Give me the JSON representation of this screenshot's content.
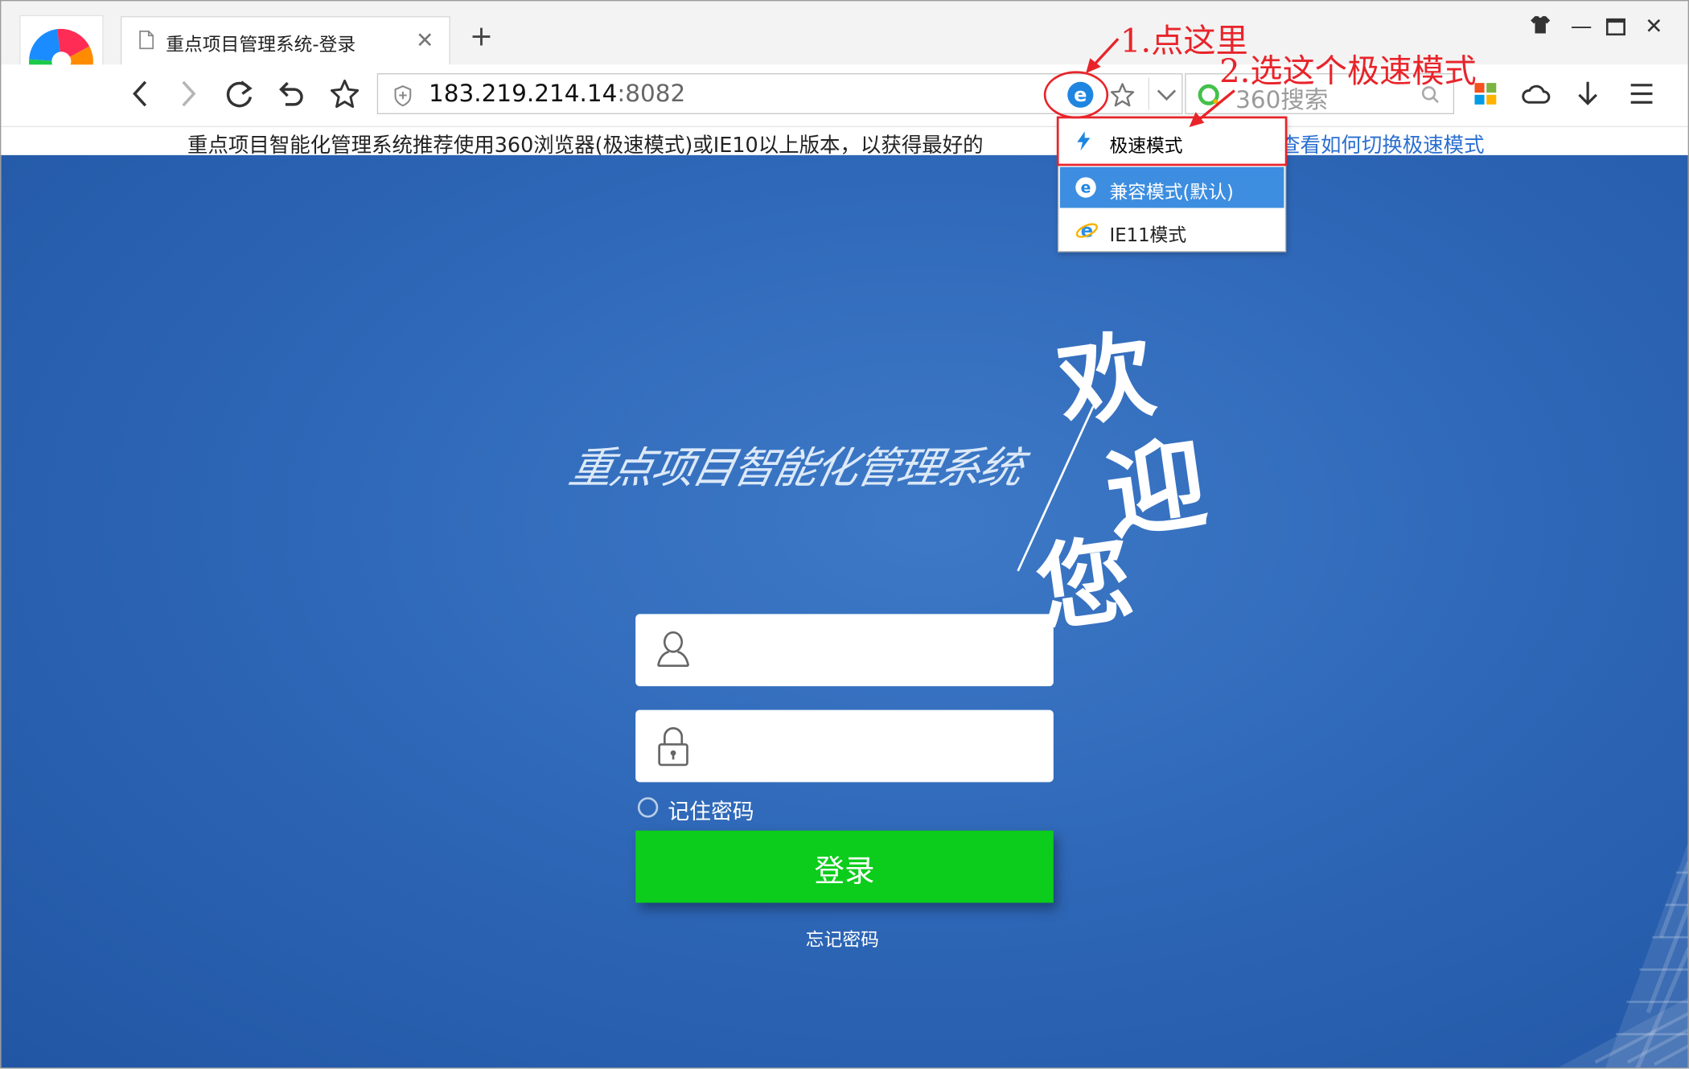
{
  "browser": {
    "tab_title": "重点项目管理系统-登录",
    "new_tab": "+",
    "url_host": "183.219.214.14",
    "url_port": ":8082",
    "search_placeholder": "360搜索"
  },
  "notice": {
    "text": "重点项目智能化管理系统推荐使用360浏览器(极速模式)或IE10以上版本，以获得最好的",
    "link": "查看如何切换极速模式"
  },
  "mode_menu": {
    "items": [
      {
        "label": "极速模式",
        "icon": "lightning-icon",
        "highlighted": false
      },
      {
        "label": "兼容模式(默认)",
        "icon": "ie-e-icon",
        "highlighted": true
      },
      {
        "label": "IE11模式",
        "icon": "ie-icon",
        "highlighted": false
      }
    ]
  },
  "annotations": {
    "step1": "1.点这里",
    "step2": "2.选这个极速模式"
  },
  "login": {
    "headline": "重点项目智能化管理系统",
    "welcome": [
      "欢",
      "迎",
      "您"
    ],
    "username_placeholder": "",
    "password_placeholder": "",
    "remember_label": "记住密码",
    "login_button": "登录",
    "forgot_link": "忘记密码"
  },
  "colors": {
    "page_bg": "#2f68b8",
    "login_button": "#0ccd1b",
    "menu_highlight": "#3d8ee0",
    "annotation_red": "#e8242a",
    "notice_link": "#2a6fd1"
  }
}
